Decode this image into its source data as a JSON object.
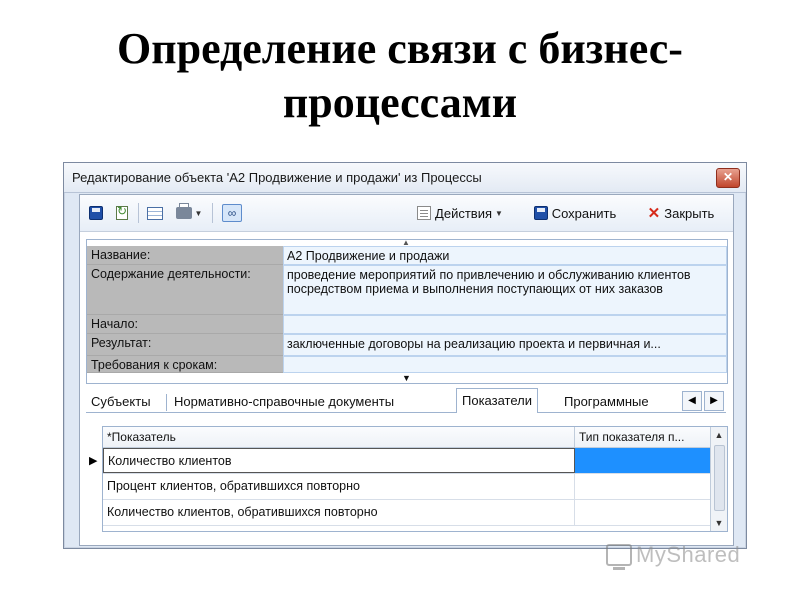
{
  "slide": {
    "title_line1": "Определение связи с бизнес-",
    "title_line2": "процессами"
  },
  "window": {
    "title": "Редактирование объекта 'А2 Продвижение и продажи' из Процессы",
    "close_glyph": "✕"
  },
  "toolbar": {
    "actions_label": "Действия",
    "save_label": "Сохранить",
    "close_label": "Закрыть"
  },
  "form": {
    "fields": [
      {
        "label": "Название:",
        "value": "А2 Продвижение и продажи"
      },
      {
        "label": "Содержание деятельности:",
        "value": "проведение мероприятий по привлечению и обслуживанию клиентов посредством приема и выполнения поступающих от них заказов"
      },
      {
        "label": "Начало:",
        "value": ""
      },
      {
        "label": "Результат:",
        "value": "заключенные договоры на реализацию проекта и первичная и..."
      },
      {
        "label": "Требования к срокам:",
        "value": ""
      }
    ]
  },
  "tabs": [
    {
      "label": "Субъекты",
      "active": false
    },
    {
      "label": "Нормативно-справочные документы",
      "active": false
    },
    {
      "label": "Показатели",
      "active": true
    },
    {
      "label": "Программные",
      "active": false
    }
  ],
  "grid": {
    "columns": [
      "*Показатель",
      "Тип показателя п..."
    ],
    "rows": [
      {
        "name": "Количество клиентов",
        "type": "",
        "selected": true
      },
      {
        "name": "Процент клиентов, обратившихся повторно",
        "type": "",
        "selected": false
      },
      {
        "name": "Количество клиентов, обратившихся повторно",
        "type": "",
        "selected": false
      }
    ]
  },
  "watermark": {
    "text": "MyShared"
  },
  "colors": {
    "selection": "#1e90ff",
    "label_bg": "#b9b9b9",
    "value_bg": "#edf5fd",
    "close_red": "#d62a1a"
  }
}
